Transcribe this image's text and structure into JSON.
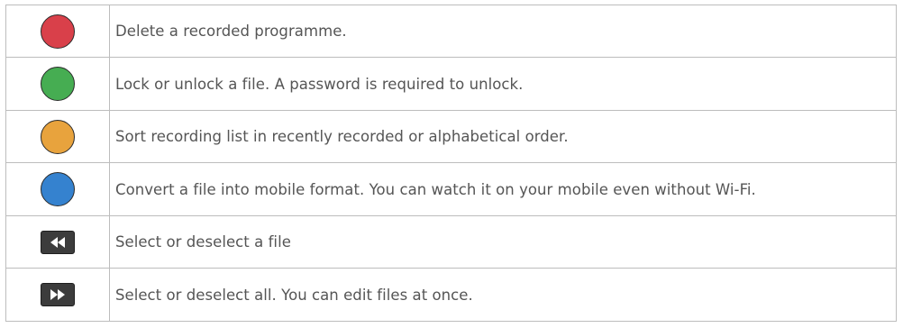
{
  "rows": [
    {
      "icon": "red-circle-button-icon",
      "color": "#d9404a",
      "text": "Delete a recorded programme."
    },
    {
      "icon": "green-circle-button-icon",
      "color": "#46ad52",
      "text": "Lock or unlock a file. A password is required to unlock."
    },
    {
      "icon": "yellow-circle-button-icon",
      "color": "#e8a33d",
      "text": "Sort recording list in recently recorded or alphabetical order."
    },
    {
      "icon": "blue-circle-button-icon",
      "color": "#3582cf",
      "text": "Convert a file into mobile format. You can watch it on your mobile even without Wi-Fi."
    },
    {
      "icon": "rewind-key-icon",
      "color": "#3c3c3c",
      "text": "Select or deselect a file"
    },
    {
      "icon": "fast-forward-key-icon",
      "color": "#3c3c3c",
      "text": "Select or deselect all. You can edit files at once."
    }
  ]
}
